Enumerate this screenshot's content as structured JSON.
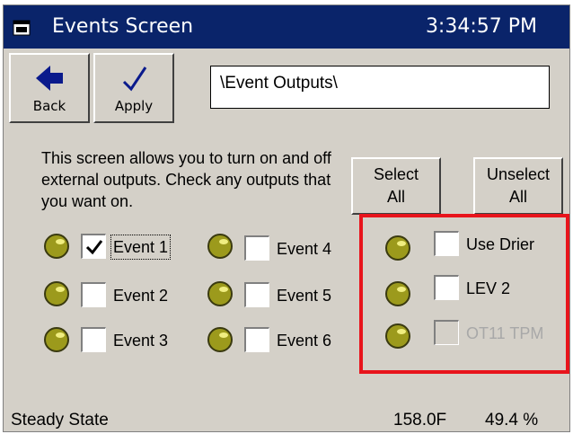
{
  "window": {
    "title": "Events Screen",
    "clock": "3:34:57 PM",
    "icon": "window-icon"
  },
  "toolbar": {
    "back_label": "Back",
    "back_icon": "arrow-left-icon",
    "apply_label": "Apply",
    "apply_icon": "checkmark-icon",
    "path": "\\Event Outputs\\"
  },
  "instructions": "This screen allows you to turn on and off external outputs.  Check any outputs that you want on.",
  "actions": {
    "select_all": [
      "Select",
      "All"
    ],
    "unselect_all": [
      "Unselect",
      "All"
    ]
  },
  "events": [
    {
      "label": "Event 1",
      "checked": true,
      "focused": true
    },
    {
      "label": "Event 2",
      "checked": false
    },
    {
      "label": "Event 3",
      "checked": false
    },
    {
      "label": "Event 4",
      "checked": false
    },
    {
      "label": "Event 5",
      "checked": false
    },
    {
      "label": "Event 6",
      "checked": false
    }
  ],
  "extra_outputs": [
    {
      "label": "Use Drier",
      "checked": false,
      "enabled": true
    },
    {
      "label": "LEV 2",
      "checked": false,
      "enabled": true
    },
    {
      "label": "OT11 TPM",
      "checked": false,
      "enabled": false
    }
  ],
  "status": {
    "state": "Steady State",
    "temperature": "158.0F",
    "percent": "49.4 %"
  },
  "colors": {
    "titlebar": "#0a246a",
    "panel": "#d4d0c8",
    "highlight": "#e8141c",
    "led": "#9c9a1c"
  }
}
